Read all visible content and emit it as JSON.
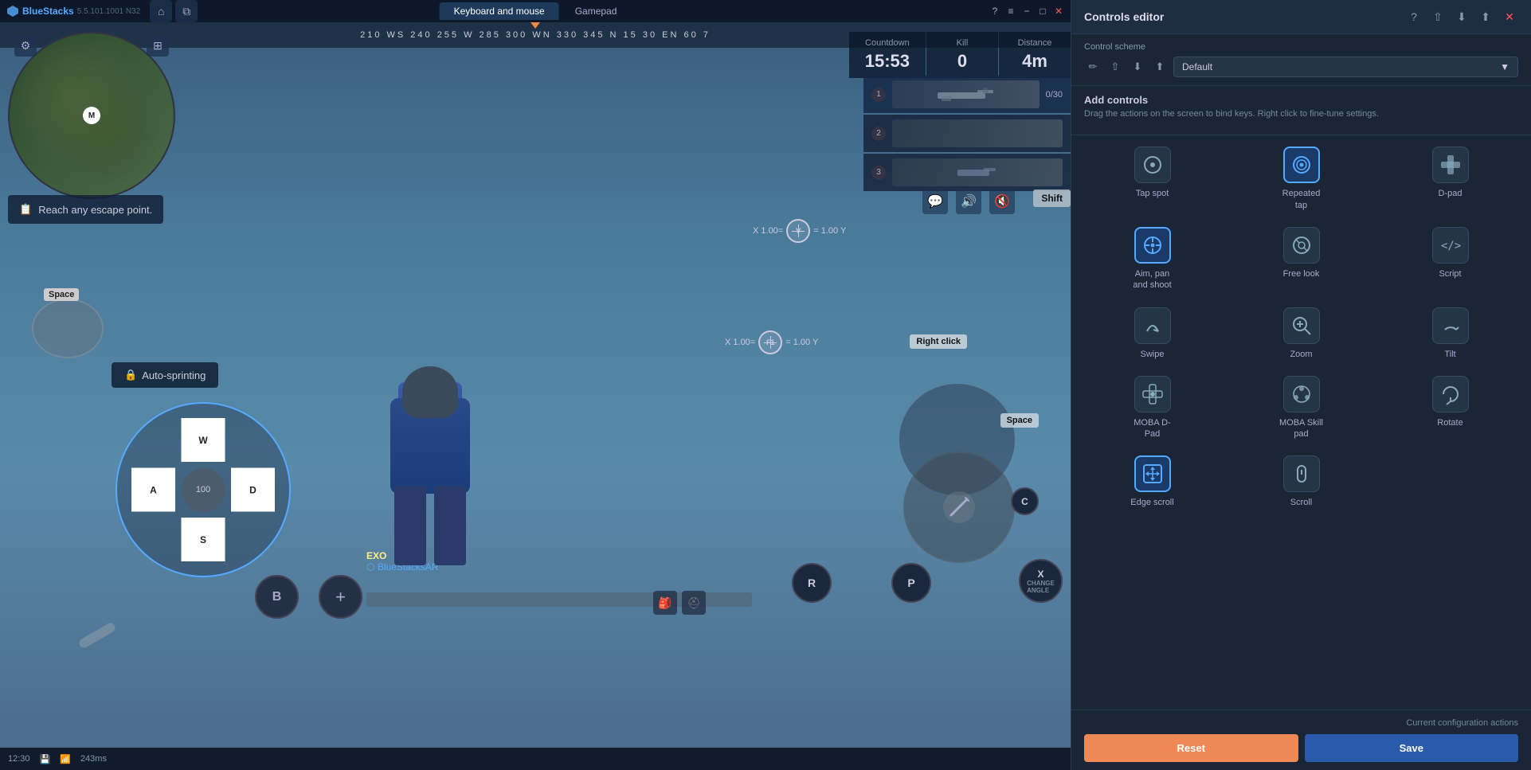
{
  "app": {
    "name": "BlueStacks",
    "version": "5.5.101.1001 N32",
    "title": "Controls editor"
  },
  "topbar": {
    "tabs": [
      {
        "label": "Keyboard and mouse",
        "active": true
      },
      {
        "label": "Gamepad",
        "active": false
      }
    ],
    "window_controls": [
      "?",
      "≡",
      "−",
      "□",
      "✕"
    ]
  },
  "hud": {
    "countdown_label": "Countdown",
    "countdown_value": "15:53",
    "kill_label": "Kill",
    "kill_value": "0",
    "distance_label": "Distance",
    "distance_value": "4m"
  },
  "compass": {
    "markers": "210  WS  240  255  W  285  300  WN  330  345  N  15  30  EN  60  7"
  },
  "objectives": {
    "text": "Reach any escape point."
  },
  "auto_sprint": {
    "label": "Auto-sprinting"
  },
  "player": {
    "name_tag": "EXO",
    "team": "BlueStacksAR"
  },
  "game_buttons": {
    "space": "Space",
    "b": "B",
    "r": "R",
    "p": "P",
    "x": "X",
    "c": "C",
    "dpad": {
      "up": "W",
      "down": "S",
      "left": "A",
      "right": "D",
      "center": "100"
    },
    "right_click": "Right click",
    "shift": "Shift",
    "space_btn": "Space"
  },
  "status_bar": {
    "time": "12:30",
    "ping": "243ms"
  },
  "controls_editor": {
    "title": "Controls editor",
    "scheme_label": "Control scheme",
    "scheme_value": "Default",
    "add_controls_title": "Add controls",
    "add_controls_desc": "Drag the actions on the screen to bind keys. Right click to fine-tune settings.",
    "items": [
      {
        "id": "tap_spot",
        "label": "Tap spot",
        "icon": "⊙",
        "highlighted": false
      },
      {
        "id": "repeated_tap",
        "label": "Repeated\ntap",
        "icon": "⊚",
        "highlighted": true
      },
      {
        "id": "dpad",
        "label": "D-pad",
        "icon": "⊞",
        "highlighted": false
      },
      {
        "id": "aim_pan_shoot",
        "label": "Aim, pan\nand shoot",
        "icon": "◎",
        "highlighted": true
      },
      {
        "id": "free_look",
        "label": "Free look",
        "icon": "⊛",
        "highlighted": false
      },
      {
        "id": "script",
        "label": "Script",
        "icon": "⟨/⟩",
        "highlighted": false
      },
      {
        "id": "swipe",
        "label": "Swipe",
        "icon": "↗",
        "highlighted": false
      },
      {
        "id": "zoom",
        "label": "Zoom",
        "icon": "⊕",
        "highlighted": false
      },
      {
        "id": "tilt",
        "label": "Tilt",
        "icon": "↻",
        "highlighted": false
      },
      {
        "id": "moba_dpad",
        "label": "MOBA D-\nPad",
        "icon": "⊠",
        "highlighted": false
      },
      {
        "id": "moba_skill",
        "label": "MOBA Skill\npad",
        "icon": "⊡",
        "highlighted": false
      },
      {
        "id": "rotate",
        "label": "Rotate",
        "icon": "↺",
        "highlighted": false
      },
      {
        "id": "edge_scroll",
        "label": "Edge scroll",
        "icon": "⤡",
        "highlighted": true
      },
      {
        "id": "scroll",
        "label": "Scroll",
        "icon": "⇅",
        "highlighted": false
      }
    ],
    "current_config_label": "Current configuration actions",
    "reset_label": "Reset",
    "save_label": "Save"
  }
}
